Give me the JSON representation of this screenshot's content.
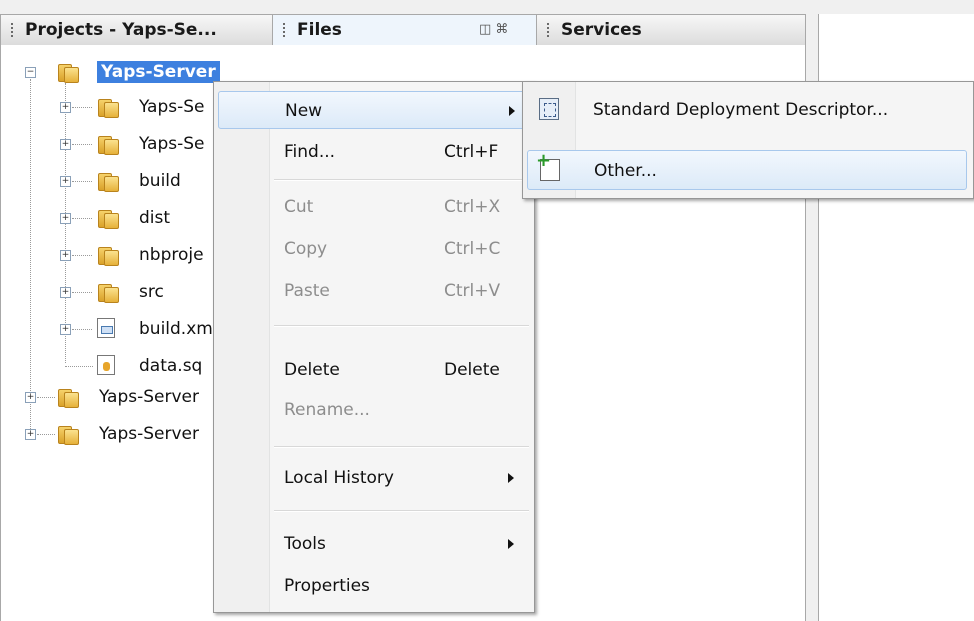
{
  "tabs": {
    "projects": "Projects - Yaps-Se...",
    "files": "Files",
    "files_controls": "◫ ⌘",
    "services": "Services"
  },
  "tree": {
    "root": "Yaps-Server",
    "children": [
      "Yaps-Se",
      "Yaps-Se",
      "build",
      "dist",
      "nbproje",
      "src",
      "build.xm",
      "data.sq"
    ],
    "siblings": [
      "Yaps-Server",
      "Yaps-Server"
    ]
  },
  "context_menu": {
    "new": "New",
    "find": "Find...",
    "find_shortcut": "Ctrl+F",
    "cut": "Cut",
    "cut_shortcut": "Ctrl+X",
    "copy": "Copy",
    "copy_shortcut": "Ctrl+C",
    "paste": "Paste",
    "paste_shortcut": "Ctrl+V",
    "delete": "Delete",
    "delete_shortcut": "Delete",
    "rename": "Rename...",
    "local_history": "Local History",
    "tools": "Tools",
    "properties": "Properties"
  },
  "submenu": {
    "standard_dd": "Standard Deployment Descriptor...",
    "other": "Other..."
  }
}
